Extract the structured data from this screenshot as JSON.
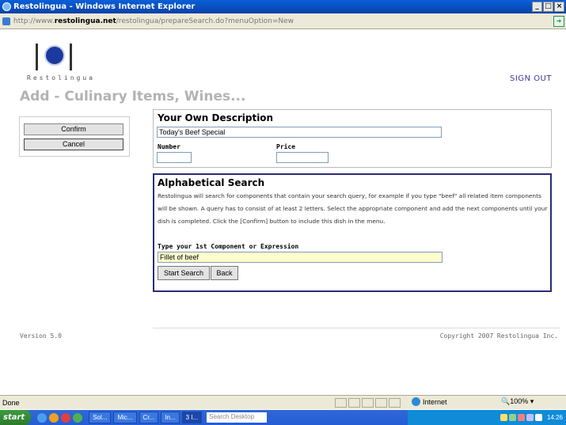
{
  "window": {
    "title": "Restolingua - Windows Internet Explorer",
    "controls": [
      "_",
      "□",
      "×"
    ]
  },
  "address": {
    "prefix": "http://www.",
    "domain": "restolingua.net",
    "path": "/restolingua/prepareSearch.do?menuOption=New"
  },
  "header": {
    "brand": "Restolingua",
    "sign_out": "SIGN OUT",
    "page_title": "Add - Culinary Items, Wines..."
  },
  "actions": {
    "confirm": "Confirm",
    "cancel": "Cancel"
  },
  "description": {
    "heading": "Your Own Description",
    "value": "Today's Beef Special",
    "number_label": "Number",
    "number_value": "",
    "price_label": "Price",
    "price_value": ""
  },
  "search": {
    "heading": "Alphabetical Search",
    "help": "Restolingua will search for components that contain your search query, for example if you type \"beef\" all related item components will be shown. A query has to consist of at least 2 letters. Select the appropriate component and add the next components until your dish is completed. Click the [Confirm] button to include this dish in the menu.",
    "component_label": "Type your 1st Component or Expression",
    "component_value": "Fillet of beef",
    "start_button": "Start Search",
    "back_button": "Back"
  },
  "footer": {
    "version": "Version 5.0",
    "copyright": "Copyright 2007 Restolingua Inc."
  },
  "statusbar": {
    "status": "Done",
    "zone": "Internet",
    "zoom": "100%"
  },
  "taskbar": {
    "start": "start",
    "tasks": [
      "Sol...",
      "Mic...",
      "Cr...",
      "In...",
      "3 I..."
    ],
    "search_placeholder": "Search Desktop",
    "clock": "14:26"
  },
  "colors": {
    "title_bar": "#0a5fd8",
    "page_title": "#b3b3b3",
    "search_border": "#2a2a7a",
    "component_bg": "#ffffcc",
    "sign_out": "#3b3b9a"
  }
}
